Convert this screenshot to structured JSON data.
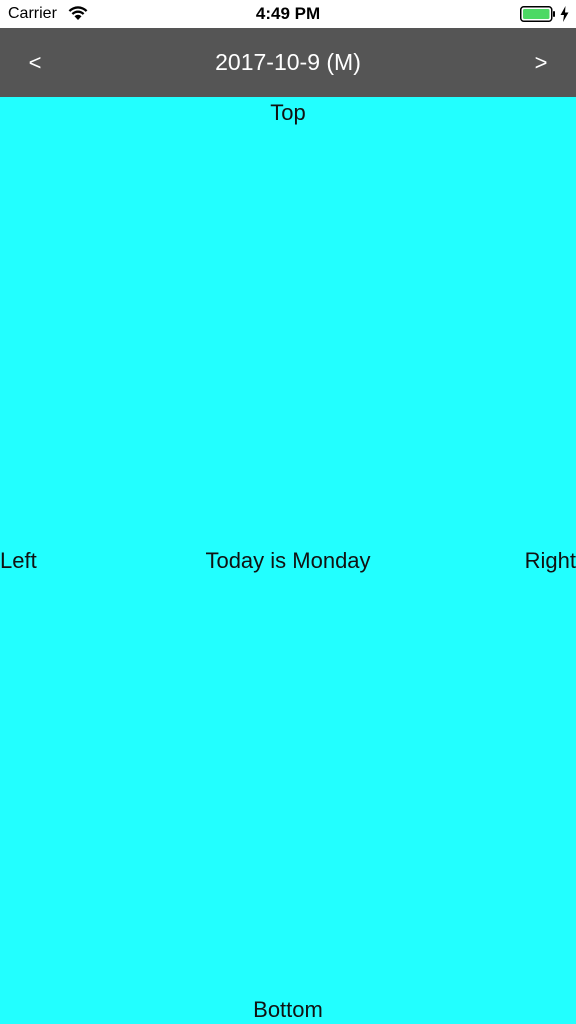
{
  "status_bar": {
    "carrier": "Carrier",
    "time": "4:49 PM",
    "battery_color": "#4cd964"
  },
  "nav": {
    "prev_label": "<",
    "title": "2017-10-9 (M)",
    "next_label": ">",
    "background": "#555555"
  },
  "content": {
    "background": "#22ffff",
    "top_label": "Top",
    "left_label": "Left",
    "center_label": "Today is Monday",
    "right_label": "Right",
    "bottom_label": "Bottom"
  }
}
